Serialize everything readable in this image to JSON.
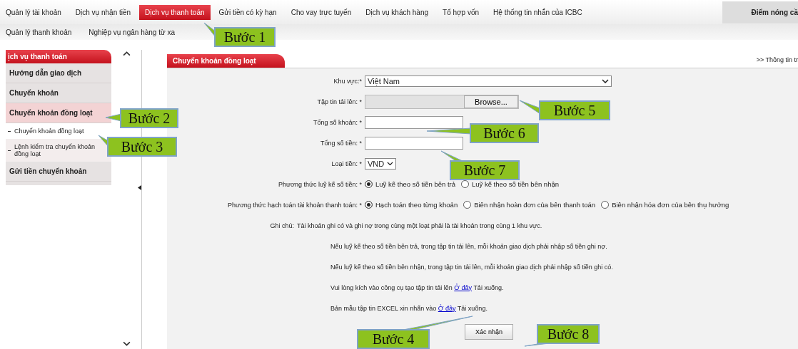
{
  "nav": {
    "items": [
      {
        "label": "Quản lý tài khoản",
        "selected": false
      },
      {
        "label": "Dịch vụ nhận tiền",
        "selected": false
      },
      {
        "label": "Dịch vụ thanh toán",
        "selected": true
      },
      {
        "label": "Gửi tiền có kỳ hạn",
        "selected": false
      },
      {
        "label": "Cho vay trực tuyến",
        "selected": false
      },
      {
        "label": "Dịch vụ khách hàng",
        "selected": false
      },
      {
        "label": "Tổ hợp vốn",
        "selected": false
      },
      {
        "label": "Hệ thống tin nhắn của ICBC",
        "selected": false
      }
    ],
    "hot": "Điểm nóng cầ"
  },
  "subnav": [
    "Quản lý thanh khoản",
    "Nghiệp vụ ngân hàng từ xa"
  ],
  "sidebar": {
    "title": "ịch vụ thanh toán",
    "items": [
      {
        "label": "Hướng dẫn giao dịch",
        "selected": false
      },
      {
        "label": "Chuyển khoản",
        "selected": false
      },
      {
        "label": "Chuyển khoản đồng loạt",
        "selected": true,
        "children": [
          {
            "label": "Chuyển khoản đồng loạt",
            "selected": true
          },
          {
            "label": "Lệnh kiểm tra chuyển khoản đồng loạt",
            "selected": false
          }
        ]
      },
      {
        "label": "Gửi tiền chuyển khoản",
        "selected": false
      }
    ]
  },
  "panel": {
    "title": "Chuyển khoản đồng loạt",
    "info_link": ">> Thông tin tr",
    "fields": [
      {
        "kind": "select",
        "label": "Khu vực:*",
        "value": "Việt Nam"
      },
      {
        "kind": "file",
        "label": "Tập tin tải lên: *",
        "button": "Browse..."
      },
      {
        "kind": "text",
        "label": "Tổng số khoản: *"
      },
      {
        "kind": "text",
        "label": "Tổng số tiền: *"
      },
      {
        "kind": "smallselect",
        "label": "Loại tiền: *",
        "value": "VND"
      },
      {
        "kind": "radios",
        "label": "Phương thức luỹ kế số tiền: *",
        "options": [
          {
            "label": "Luỹ kế theo số tiền bên trả",
            "selected": true
          },
          {
            "label": "Luỹ kế theo số tiền bên nhận",
            "selected": false
          }
        ]
      },
      {
        "kind": "radios",
        "label": "Phương thức hạch toán tài khoản thanh toán: *",
        "options": [
          {
            "label": "Hạch toán theo từng khoản",
            "selected": true
          },
          {
            "label": "Biên nhận hoàn đơn của bên thanh toán",
            "selected": false
          },
          {
            "label": "Biên nhận hóa đơn của bên thụ hưởng",
            "selected": false
          }
        ]
      }
    ],
    "notes_label": "Ghi chú:",
    "notes": [
      {
        "text": "Tài khoản ghi có và ghi nợ trong cùng một loạt phải là tài khoản trong cùng 1 khu vực."
      },
      {
        "text": "Nếu luỹ kế theo số tiền bên trả, trong tập tin tải lên, mỗi khoản giao dịch phải nhập số tiền ghi nợ."
      },
      {
        "text": "Nếu luỹ kế theo số tiền bên nhận, trong tập tin tải lên, mỗi khoản giao dịch phải nhập số tiền ghi có."
      },
      {
        "text": "Vui lòng kích vào công cụ tạo tập tin tải lên",
        "link": "Ở đây",
        "after": "Tải xuống."
      },
      {
        "text": "Bản mẫu tập tin EXCEL xin nhấn vào",
        "link": "Ở đây",
        "after": "Tải xuống."
      }
    ],
    "submit": "Xác nhận"
  },
  "callouts": [
    "Bước 1",
    "Bước 2",
    "Bước 3",
    "Bước 4",
    "Bước 5",
    "Bước 6",
    "Bước 7",
    "Bước 8"
  ]
}
